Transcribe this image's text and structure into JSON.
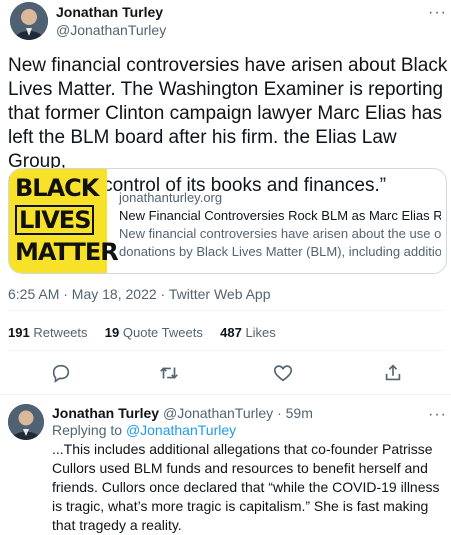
{
  "main_tweet": {
    "author_name": "Jonathan Turley",
    "author_handle": "@JonathanTurley",
    "text": "New financial controversies have arisen about Black\nLives Matter. The Washington Examiner is reporting\nthat former Clinton campaign lawyer Marc Elias has\nleft the BLM board after his firm. the Elias Law Group,\nhad “taken control of its books and finances.”",
    "card": {
      "image_text": [
        "BLACK",
        "LIVES",
        "MATTER"
      ],
      "domain": "jonathanturley.org",
      "title": "New Financial Controversies Rock BLM as Marc Elias Repor...",
      "description_line1": "New financial controversies have arisen about the use of",
      "description_line2": "donations by Black Lives Matter (BLM), including additional..."
    },
    "timestamp": "6:25 AM · May 18, 2022 · Twitter Web App",
    "stats": {
      "retweets_count": "191",
      "retweets_label": "Retweets",
      "quotes_count": "19",
      "quotes_label": "Quote Tweets",
      "likes_count": "487",
      "likes_label": "Likes"
    },
    "actions": [
      "reply-icon",
      "retweet-icon",
      "like-icon",
      "share-icon"
    ]
  },
  "reply_tweet": {
    "author_name": "Jonathan Turley",
    "author_handle": "@JonathanTurley",
    "time": "· 59m",
    "replying_prefix": "Replying to",
    "replying_to": "@JonathanTurley",
    "text": "...This includes additional allegations that co-founder Patrisse Cullors used BLM funds and resources to benefit herself and friends. Cullors once declared that “while the COVID-19 illness is tragic, what’s more tragic is capitalism.” She is fast making that tragedy a reality."
  },
  "more_label": "···",
  "colors": {
    "accent": "#1d9bf0",
    "text": "#0f1419",
    "muted": "#536471",
    "card_bg": "#f7e229"
  }
}
